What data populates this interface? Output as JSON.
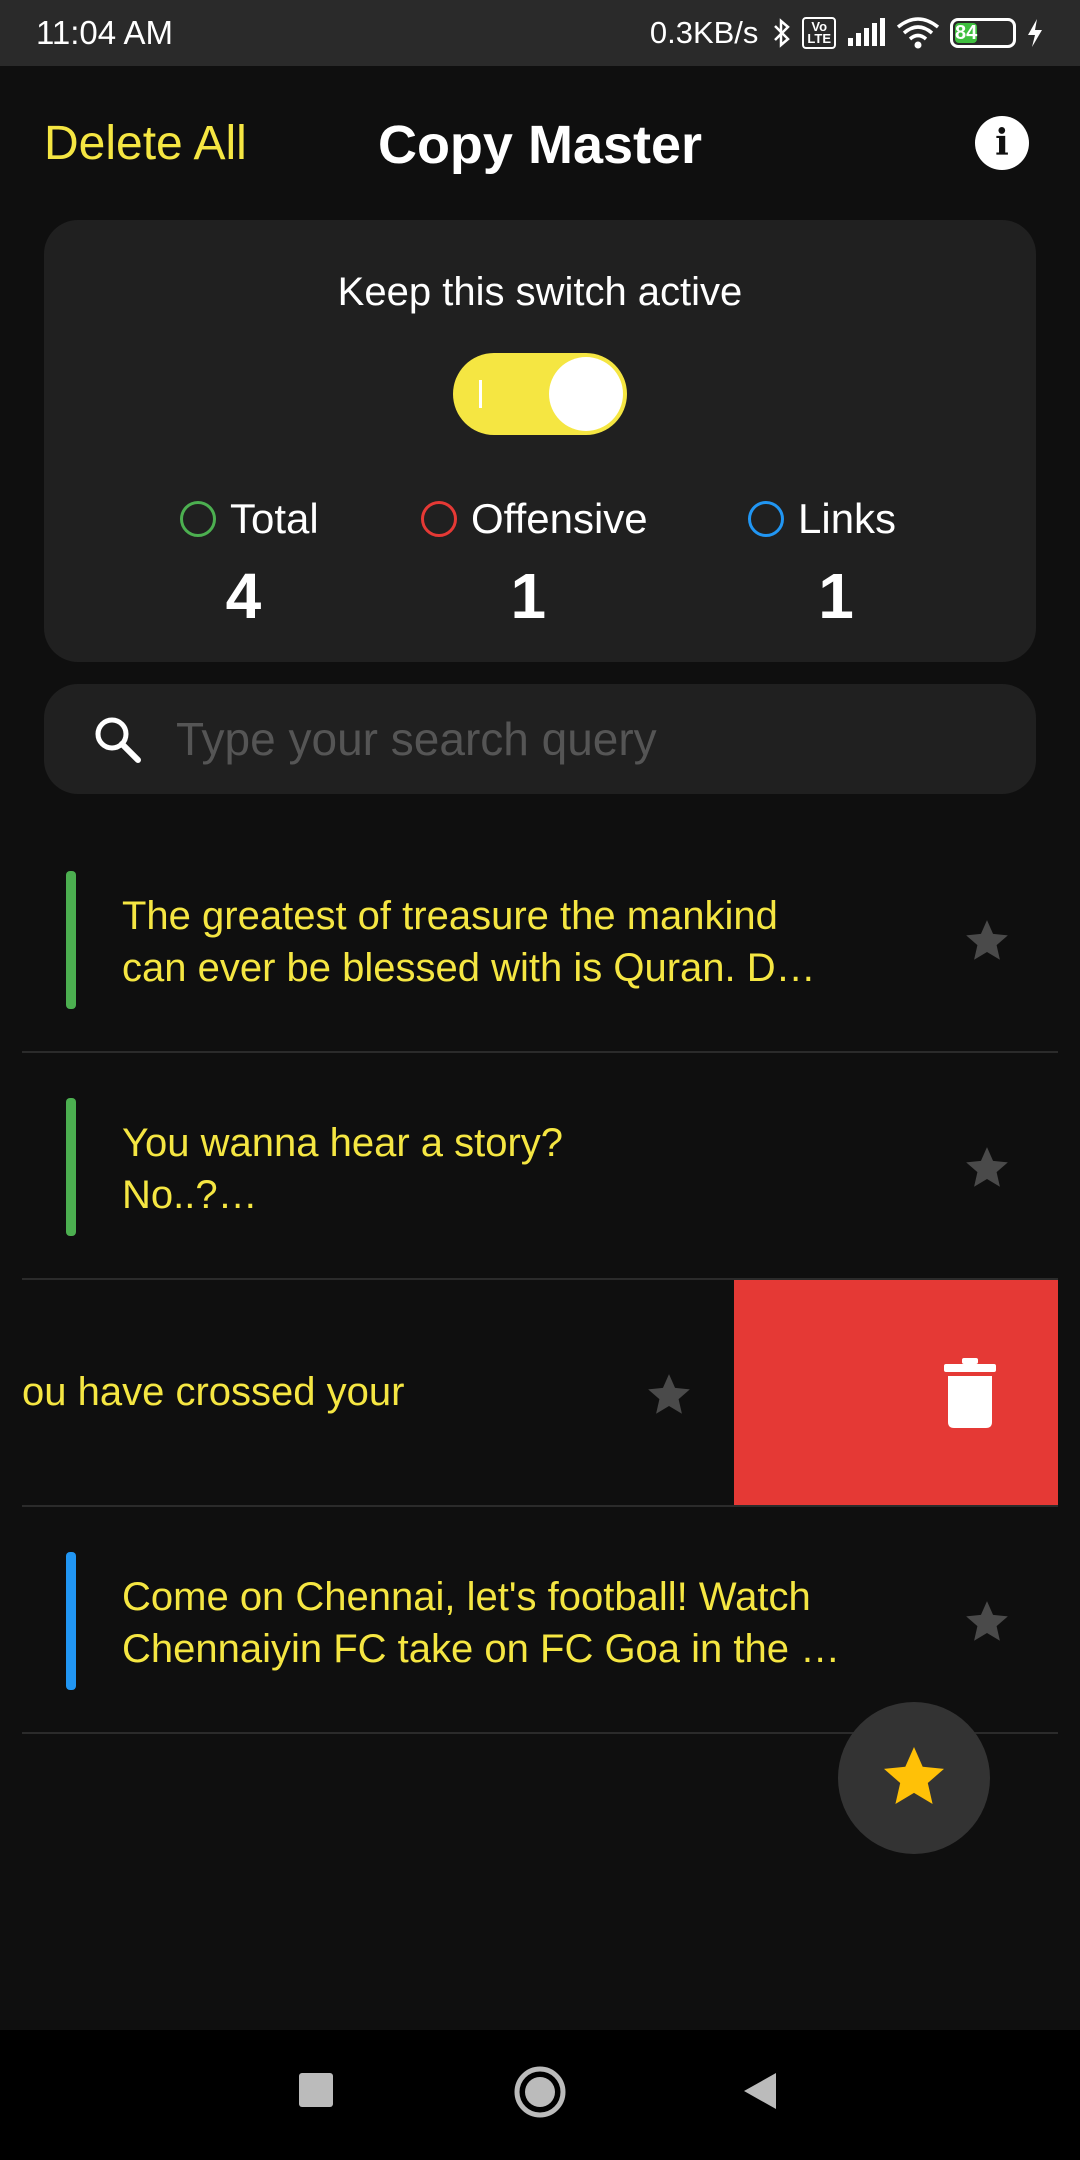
{
  "status_bar": {
    "time": "11:04 AM",
    "network_speed": "0.3KB/s",
    "volte_label": "Vo LTE",
    "battery_level": "84",
    "icons": [
      "bluetooth-icon",
      "volte-icon",
      "signal-icon",
      "wifi-icon",
      "battery-icon",
      "charging-icon"
    ]
  },
  "app_bar": {
    "delete_all_label": "Delete All",
    "title": "Copy Master",
    "info_icon": "info-icon"
  },
  "stats_card": {
    "switch_label": "Keep this switch active",
    "switch_on": true,
    "stats": [
      {
        "label": "Total",
        "value": "4",
        "color": "#4caf50"
      },
      {
        "label": "Offensive",
        "value": "1",
        "color": "#e53935"
      },
      {
        "label": "Links",
        "value": "1",
        "color": "#2196f3"
      }
    ]
  },
  "search": {
    "placeholder": "Type your search query",
    "value": ""
  },
  "clips": [
    {
      "text": "The greatest of treasure the mankind\ncan ever be blessed with is Quran. D…",
      "accent": "#4caf50",
      "starred": false
    },
    {
      "text": "You wanna hear a story?\nNo..?…",
      "accent": "#4caf50",
      "starred": false
    },
    {
      "text": "ou have crossed your",
      "accent": "",
      "starred": false,
      "swiped": true
    },
    {
      "text": "Come on Chennai, let's football! Watch\nChennaiyin FC take on FC Goa in the …",
      "accent": "#2196f3",
      "starred": false
    }
  ],
  "colors": {
    "accent_yellow": "#f5e642",
    "delete_red": "#e53935",
    "fab_star": "#ffc107",
    "star_inactive": "#4a4a4a"
  },
  "fab": {
    "icon": "star-icon"
  },
  "nav_bar": {
    "icons": [
      "recents-square-icon",
      "home-circle-icon",
      "back-triangle-icon"
    ]
  }
}
